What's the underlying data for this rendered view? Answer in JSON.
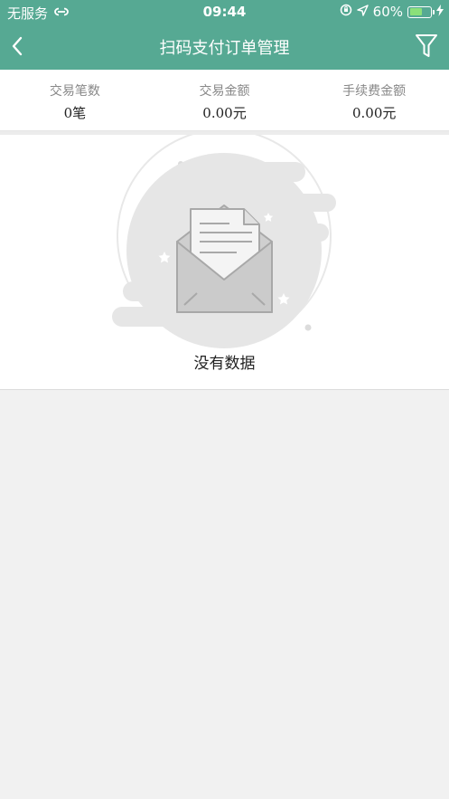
{
  "status_bar": {
    "carrier": "无服务",
    "time": "09:44",
    "battery_percent": "60%",
    "battery_level": 0.6
  },
  "nav": {
    "title": "扫码支付订单管理"
  },
  "summary": [
    {
      "label": "交易笔数",
      "value": "0笔"
    },
    {
      "label": "交易金额",
      "value": "0.00元"
    },
    {
      "label": "手续费金额",
      "value": "0.00元"
    }
  ],
  "empty_state": {
    "message": "没有数据"
  },
  "colors": {
    "header_bg": "#56a993",
    "page_bg": "#f1f1f1",
    "battery_fill": "#8be07a"
  }
}
